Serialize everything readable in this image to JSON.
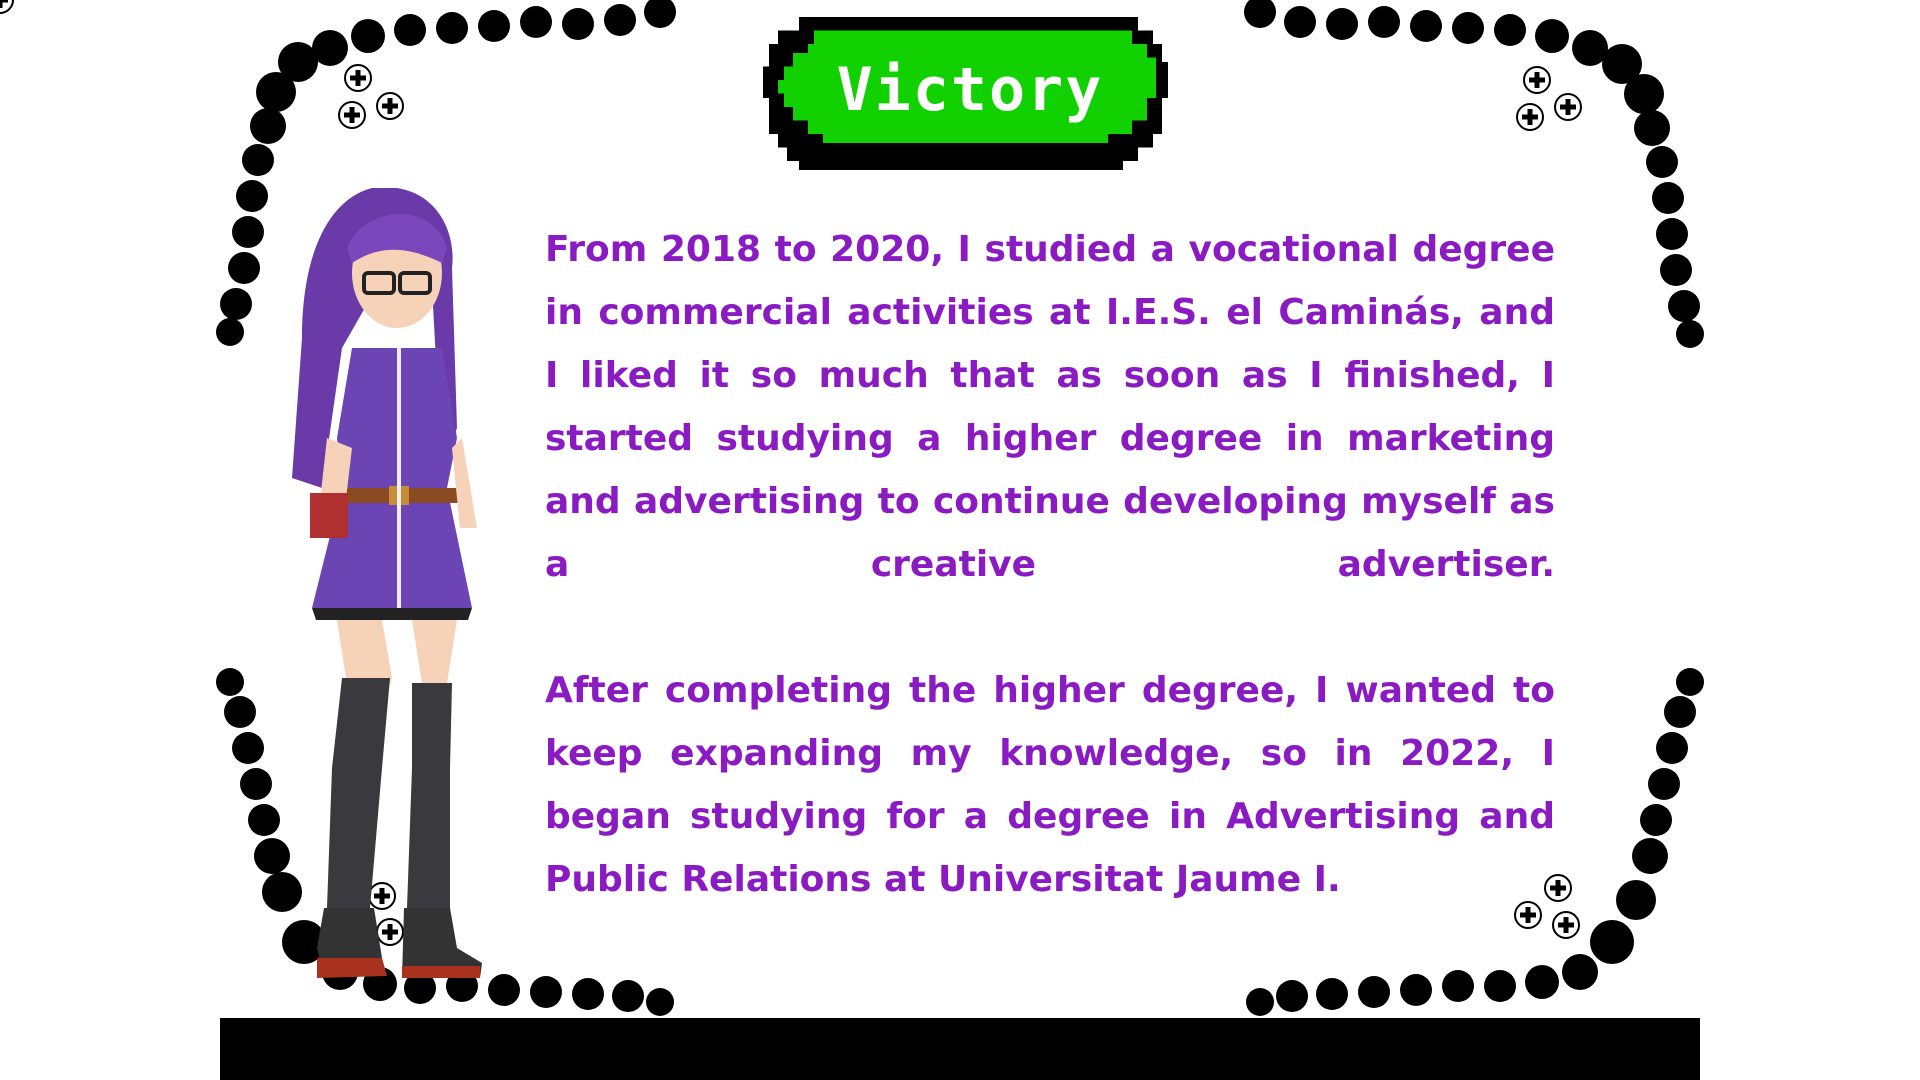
{
  "title": "Victory",
  "paragraphs": [
    "From 2018 to 2020, I studied a vocational degree in commercial activities at I.E.S. el Caminás, and I liked it so much that as soon as I finished, I started studying a higher degree in marketing and advertising to continue developing myself as a creative advertiser.",
    "After completing the higher degree, I wanted to keep expanding my knowledge, so in 2022, I began studying for a degree in Advertising and Public Relations at Universitat Jaume I."
  ],
  "colors": {
    "title_bg": "#11d100",
    "text": "#8a1bc2",
    "frame": "#000000"
  }
}
